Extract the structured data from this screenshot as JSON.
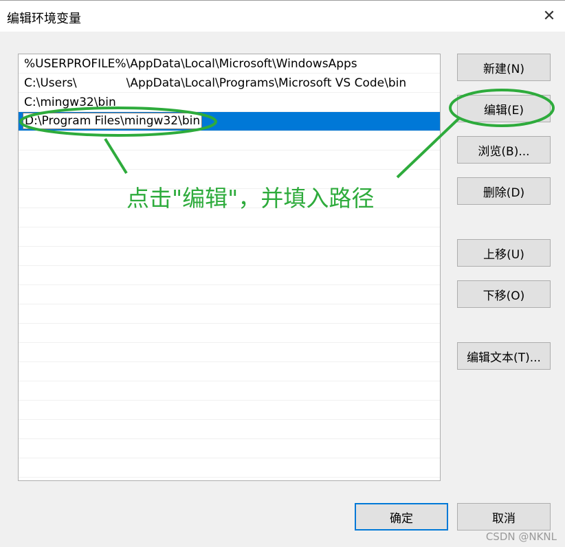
{
  "window": {
    "title": "编辑环境变量",
    "close_glyph": "✕"
  },
  "list": {
    "rows": [
      {
        "text": "%USERPROFILE%\\AppData\\Local\\Microsoft\\WindowsApps"
      },
      {
        "text_a": "C:\\Users\\",
        "text_b": "\\AppData\\Local\\Programs\\Microsoft VS Code\\bin"
      },
      {
        "text": "C:\\mingw32\\bin"
      },
      {
        "text": "D:\\Program Files\\mingw32\\bin",
        "selected": true,
        "editing": true
      }
    ]
  },
  "buttons": {
    "new": "新建(N)",
    "edit": "编辑(E)",
    "browse": "浏览(B)...",
    "delete": "删除(D)",
    "move_up": "上移(U)",
    "move_down": "下移(O)",
    "edit_text": "编辑文本(T)...",
    "ok": "确定",
    "cancel": "取消"
  },
  "annotation": {
    "text": "点击\"编辑\"，并填入路径",
    "color": "#2eab3c"
  },
  "watermark": "CSDN @NKNL",
  "colors": {
    "selection": "#0078d7",
    "annotation_green": "#2eab3c"
  }
}
